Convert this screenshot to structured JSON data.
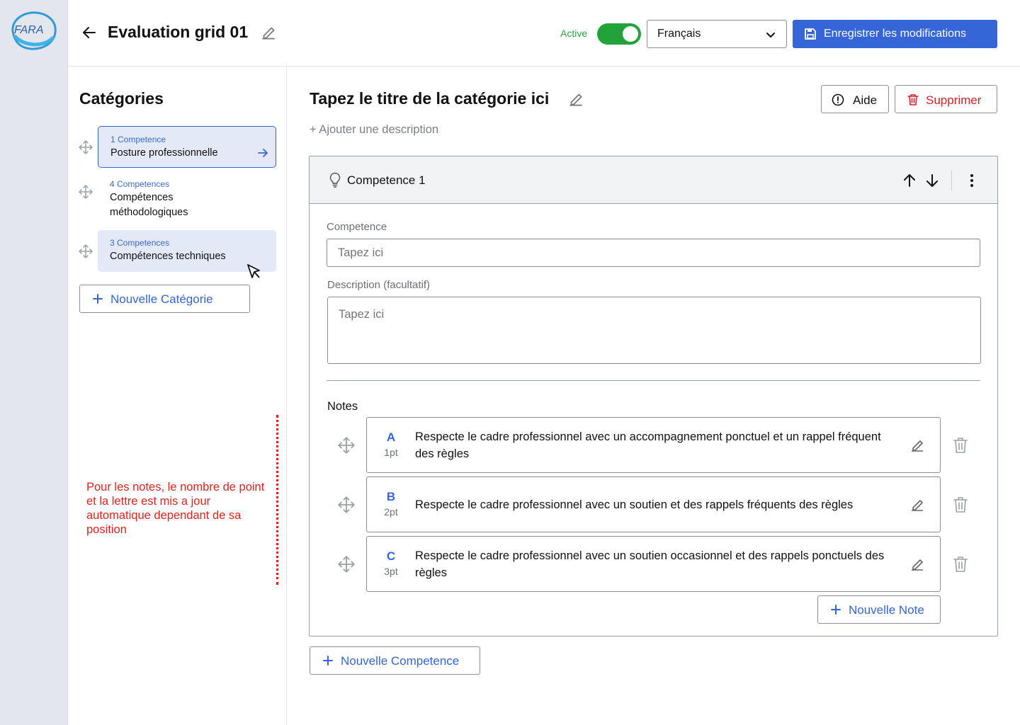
{
  "brand": {
    "logo_text": "FARA"
  },
  "header": {
    "title": "Evaluation grid 01",
    "active_label": "Active",
    "active_on": true,
    "language": "Français",
    "save_label": "Enregistrer les modifications"
  },
  "sidebar": {
    "title": "Catégories",
    "categories": [
      {
        "count": "1 Competence",
        "name": "Posture professionnelle",
        "state": "selected"
      },
      {
        "count": "4 Competences",
        "name": "Compétences méthodologiques",
        "state": "default"
      },
      {
        "count": "3 Competences",
        "name": "Compétences techniques",
        "state": "hover"
      }
    ],
    "new_category_label": "Nouvelle Catégorie",
    "annotation": "Pour les notes, le nombre de point et la lettre est mis a jour automatique dependant de sa position"
  },
  "main": {
    "category_title": "Tapez le titre de la catégorie ici",
    "add_description": "+ Ajouter une description",
    "help_label": "Aide",
    "delete_label": "Supprimer",
    "competence": {
      "name": "Competence 1",
      "competence_label": "Competence",
      "competence_placeholder": "Tapez ici",
      "description_label": "Description (facultatif)",
      "description_placeholder": "Tapez ici",
      "notes_label": "Notes",
      "notes": [
        {
          "letter": "A",
          "points": "1pt",
          "text": "Respecte le cadre professionnel avec un accompagnement ponctuel et un rappel fréquent des règles"
        },
        {
          "letter": "B",
          "points": "2pt",
          "text": "Respecte le cadre professionnel avec un soutien et des rappels fréquents des règles"
        },
        {
          "letter": "C",
          "points": "3pt",
          "text": "Respecte le cadre professionnel avec un soutien occasionnel et des rappels ponctuels des règles"
        }
      ],
      "new_note_label": "Nouvelle Note"
    },
    "new_competence_label": "Nouvelle Competence"
  },
  "colors": {
    "accent": "#3565d6",
    "toggle_on": "#22a33a",
    "danger": "#d4222a",
    "annotation": "#e0241b",
    "selected_bg": "#e3e9f7",
    "rail_bg": "#e3e6ec"
  },
  "icons": [
    "arrow-left-icon",
    "pencil-icon",
    "chevron-down-icon",
    "save-icon",
    "drag-move-icon",
    "arrow-right-icon",
    "pointer-cursor-icon",
    "plus-icon",
    "alert-circle-icon",
    "trash-icon",
    "lightbulb-icon",
    "arrow-up-icon",
    "arrow-down-icon",
    "more-vertical-icon"
  ]
}
